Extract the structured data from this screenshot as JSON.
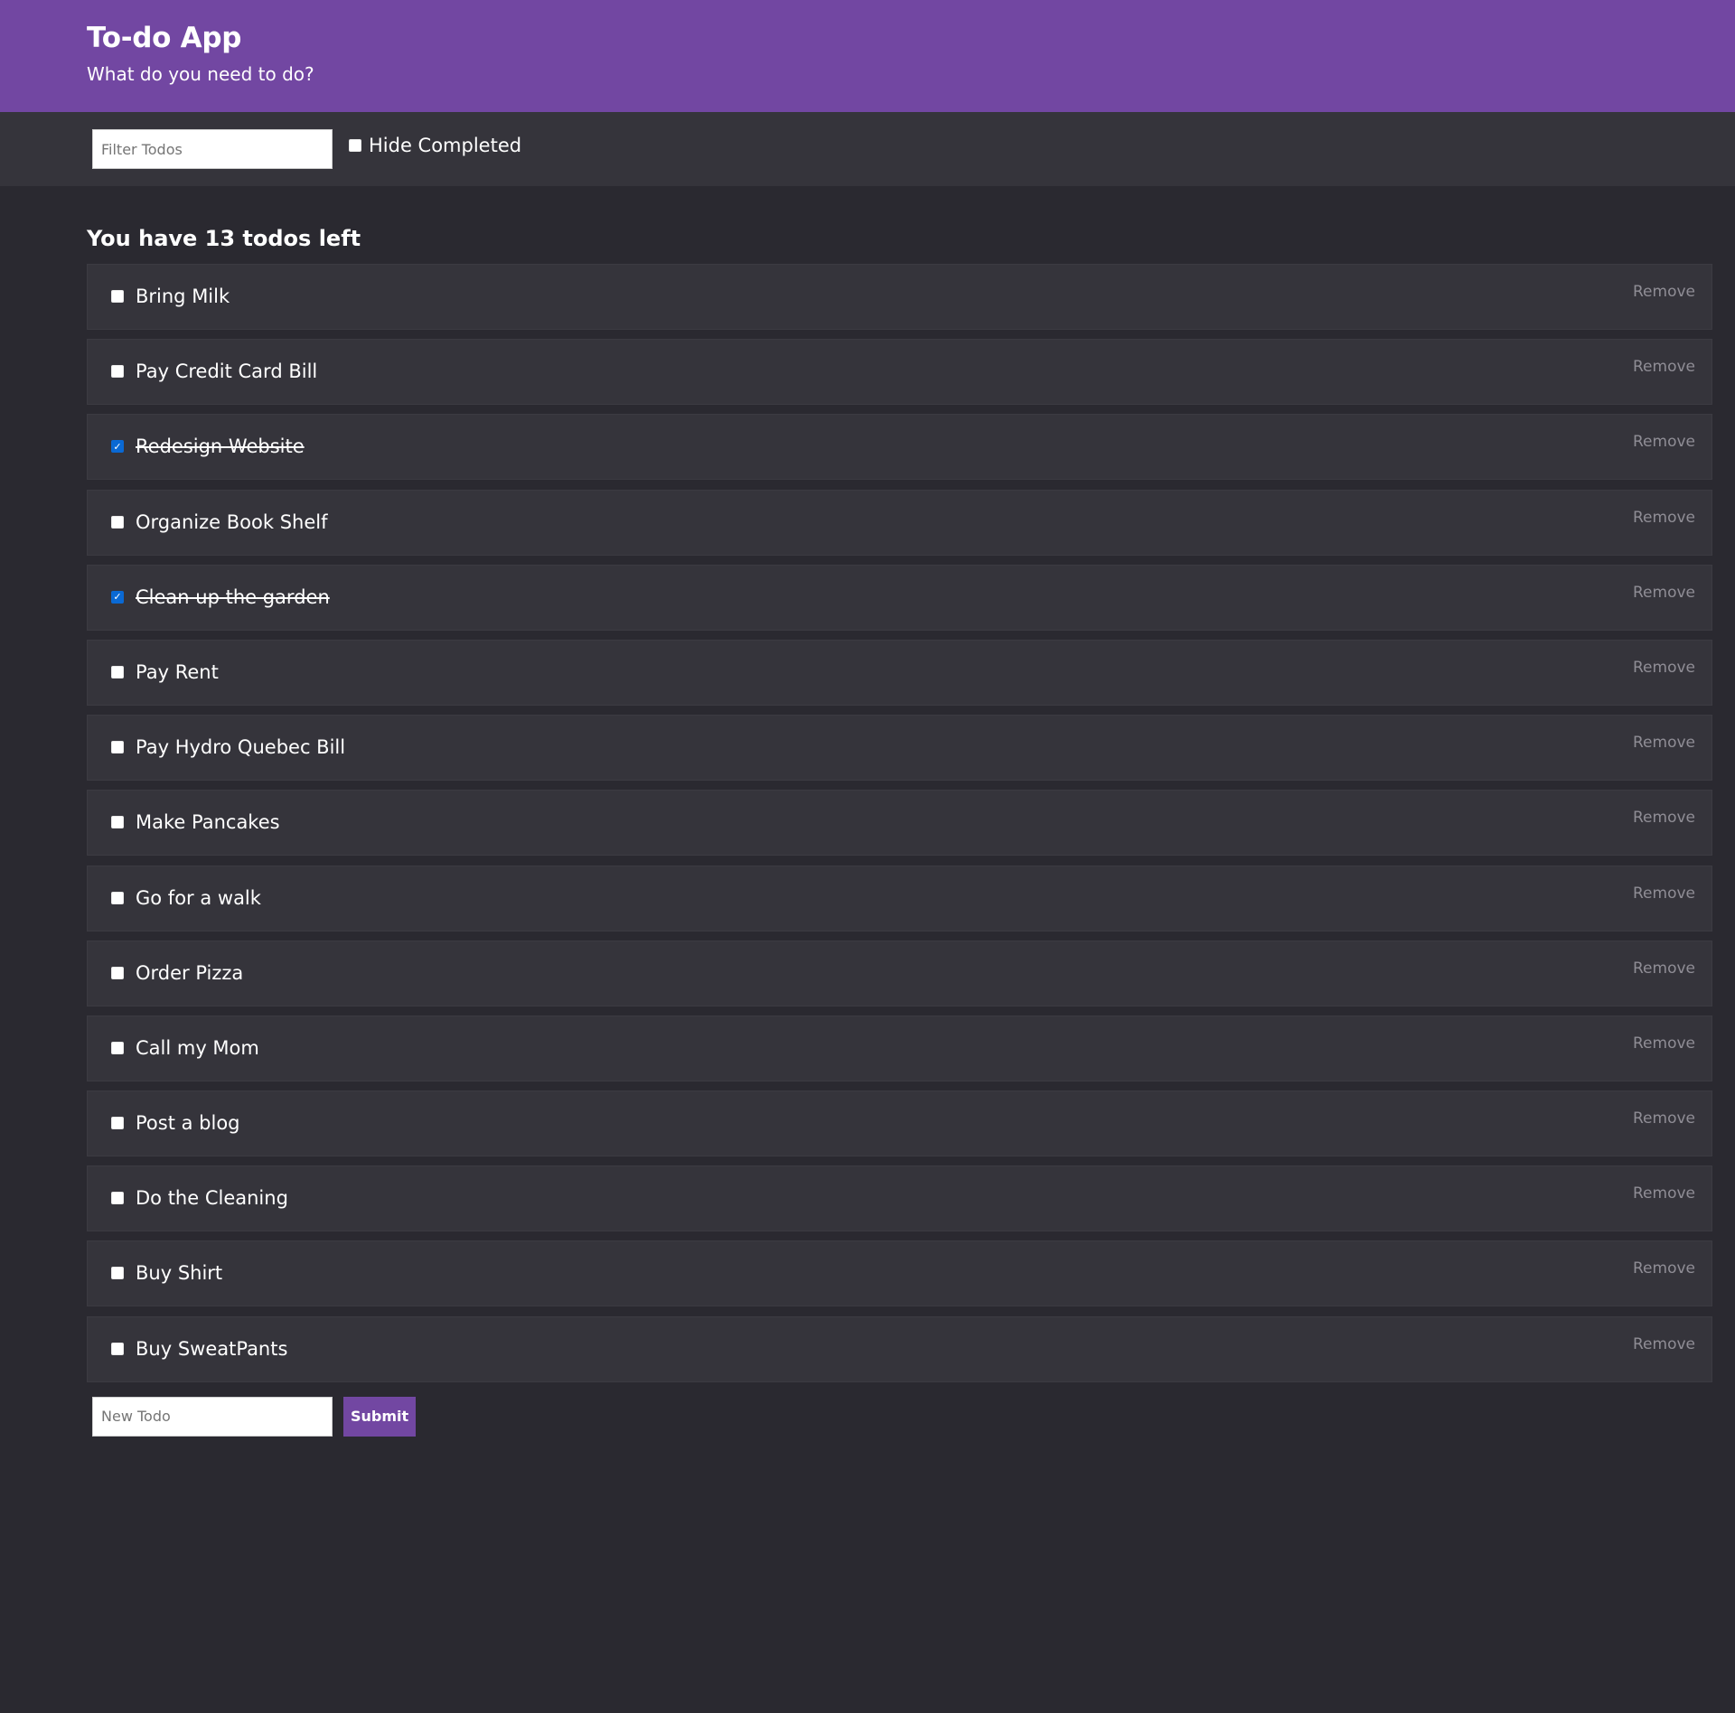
{
  "header": {
    "title": "To-do App",
    "subtitle": "What do you need to do?"
  },
  "filter": {
    "placeholder": "Filter Todos",
    "value": "",
    "hide_completed_label": "Hide Completed",
    "hide_completed_checked": false
  },
  "summary": {
    "text": "You have 13 todos left"
  },
  "todos": [
    {
      "text": "Bring Milk",
      "completed": false,
      "remove_label": "Remove"
    },
    {
      "text": "Pay Credit Card Bill",
      "completed": false,
      "remove_label": "Remove"
    },
    {
      "text": "Redesign Website",
      "completed": true,
      "remove_label": "Remove"
    },
    {
      "text": "Organize Book Shelf",
      "completed": false,
      "remove_label": "Remove"
    },
    {
      "text": "Clean up the garden",
      "completed": true,
      "remove_label": "Remove"
    },
    {
      "text": "Pay Rent",
      "completed": false,
      "remove_label": "Remove"
    },
    {
      "text": "Pay Hydro Quebec Bill",
      "completed": false,
      "remove_label": "Remove"
    },
    {
      "text": "Make Pancakes",
      "completed": false,
      "remove_label": "Remove"
    },
    {
      "text": "Go for a walk",
      "completed": false,
      "remove_label": "Remove"
    },
    {
      "text": "Order Pizza",
      "completed": false,
      "remove_label": "Remove"
    },
    {
      "text": "Call my Mom",
      "completed": false,
      "remove_label": "Remove"
    },
    {
      "text": "Post a blog",
      "completed": false,
      "remove_label": "Remove"
    },
    {
      "text": "Do the Cleaning",
      "completed": false,
      "remove_label": "Remove"
    },
    {
      "text": "Buy Shirt",
      "completed": false,
      "remove_label": "Remove"
    },
    {
      "text": "Buy SweatPants",
      "completed": false,
      "remove_label": "Remove"
    }
  ],
  "add_form": {
    "placeholder": "New Todo",
    "value": "",
    "submit_label": "Submit"
  },
  "colors": {
    "header_bg": "#7247a2",
    "page_bg": "#2a2930",
    "panel_bg": "#35343b",
    "checkbox_checked": "#0a69d4",
    "remove_text": "#8f8d95"
  }
}
